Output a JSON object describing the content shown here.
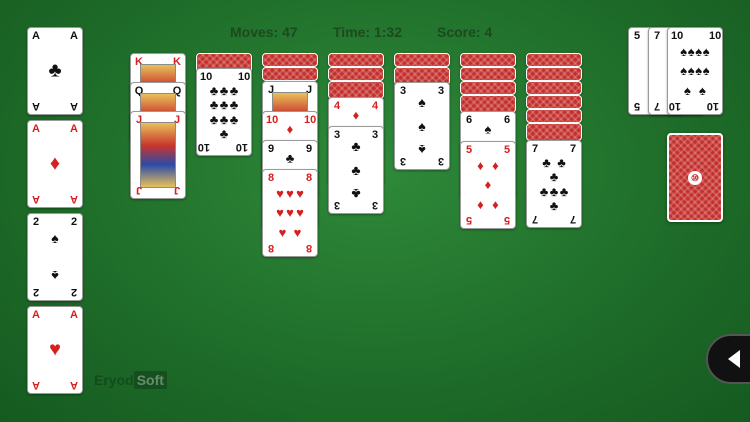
{
  "status": {
    "moves": "Moves: 47",
    "time": "Time: 1:32",
    "score": "Score: 4"
  },
  "brand": {
    "part1": "Eryod",
    "part2": "Soft"
  },
  "stock_logo": "⑩",
  "foundations": [
    {
      "rank": "A",
      "suit": "♣",
      "color": "black"
    },
    {
      "rank": "A",
      "suit": "♦",
      "color": "red"
    },
    {
      "rank": "2",
      "suit": "♠",
      "color": "black"
    },
    {
      "rank": "A",
      "suit": "♥",
      "color": "red"
    }
  ],
  "tableau": {
    "col1": [
      {
        "rank": "K",
        "suit": "♦",
        "color": "red"
      },
      {
        "rank": "Q",
        "suit": "♠",
        "color": "black"
      },
      {
        "rank": "J",
        "suit": "♦",
        "color": "red"
      }
    ],
    "col2": [
      {
        "rank": "10",
        "suit": "♣",
        "color": "black"
      }
    ],
    "col3": [
      {
        "rank": "J",
        "suit": "♠",
        "color": "black"
      },
      {
        "rank": "10",
        "suit": "♦",
        "color": "red"
      },
      {
        "rank": "9",
        "suit": "♣",
        "color": "black"
      },
      {
        "rank": "8",
        "suit": "♥",
        "color": "red"
      }
    ],
    "col4": [
      {
        "rank": "4",
        "suit": "♦",
        "color": "red"
      },
      {
        "rank": "3",
        "suit": "♣",
        "color": "black"
      }
    ],
    "col5": [
      {
        "rank": "3",
        "suit": "♠",
        "color": "black"
      }
    ],
    "col6": [
      {
        "rank": "6",
        "suit": "♠",
        "color": "black"
      },
      {
        "rank": "5",
        "suit": "♦",
        "color": "red"
      }
    ],
    "col7": [
      {
        "rank": "7",
        "suit": "♣",
        "color": "black"
      }
    ]
  },
  "waste": [
    {
      "rank": "5",
      "suit": "♠",
      "color": "black"
    },
    {
      "rank": "7",
      "suit": "♠",
      "color": "black"
    },
    {
      "rank": "10",
      "suit": "♠",
      "color": "black"
    }
  ]
}
